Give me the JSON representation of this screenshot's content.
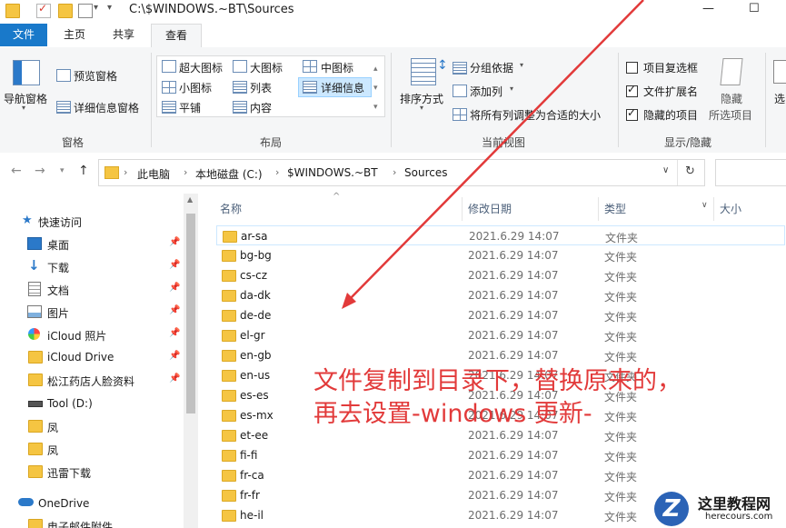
{
  "window": {
    "title": "C:\\$WINDOWS.~BT\\Sources",
    "minimize_glyph": "—",
    "maximize_glyph": "☐"
  },
  "tabs": [
    {
      "label": "文件"
    },
    {
      "label": "主页"
    },
    {
      "label": "共享"
    },
    {
      "label": "查看"
    }
  ],
  "ribbon": {
    "panes": {
      "nav_pane": "导航窗格",
      "preview_pane": "预览窗格",
      "details_pane": "详细信息窗格",
      "group_label": "窗格"
    },
    "layout": {
      "items": [
        "超大图标",
        "大图标",
        "中图标",
        "小图标",
        "列表",
        "详细信息",
        "平铺",
        "内容"
      ],
      "group_label": "布局"
    },
    "current_view": {
      "sort": "排序方式",
      "group_by": "分组依据",
      "add_column": "添加列",
      "fit_columns": "将所有列调整为合适的大小",
      "group_label": "当前视图"
    },
    "show_hide": {
      "item_checkbox": "项目复选框",
      "file_ext": "文件扩展名",
      "hidden_items": "隐藏的项目",
      "hide": "隐藏",
      "selected_items": "所选项目",
      "group_label": "显示/隐藏"
    },
    "options_partial": "选"
  },
  "address": {
    "crumbs": [
      "此电脑",
      "本地磁盘 (C:)",
      "$WINDOWS.~BT",
      "Sources"
    ]
  },
  "nav": {
    "quick_access": "快速访问",
    "items": [
      {
        "label": "桌面"
      },
      {
        "label": "下载"
      },
      {
        "label": "文档"
      },
      {
        "label": "图片"
      },
      {
        "label": "iCloud 照片"
      },
      {
        "label": "iCloud Drive"
      },
      {
        "label": "松江药店人脸资料"
      },
      {
        "label": "Tool (D:)"
      },
      {
        "label": "凤"
      },
      {
        "label": "凤"
      },
      {
        "label": "迅雷下载"
      }
    ],
    "onedrive": "OneDrive",
    "onedrive_child": "电子邮件附件"
  },
  "columns": {
    "name": "名称",
    "date": "修改日期",
    "type": "类型",
    "size": "大小"
  },
  "files": [
    {
      "name": "ar-sa",
      "date": "2021.6.29 14:07",
      "type": "文件夹"
    },
    {
      "name": "bg-bg",
      "date": "2021.6.29 14:07",
      "type": "文件夹"
    },
    {
      "name": "cs-cz",
      "date": "2021.6.29 14:07",
      "type": "文件夹"
    },
    {
      "name": "da-dk",
      "date": "2021.6.29 14:07",
      "type": "文件夹"
    },
    {
      "name": "de-de",
      "date": "2021.6.29 14:07",
      "type": "文件夹"
    },
    {
      "name": "el-gr",
      "date": "2021.6.29 14:07",
      "type": "文件夹"
    },
    {
      "name": "en-gb",
      "date": "2021.6.29 14:07",
      "type": "文件夹"
    },
    {
      "name": "en-us",
      "date": "2021.6.29 14:07",
      "type": "文件夹"
    },
    {
      "name": "es-es",
      "date": "2021.6.29 14:07",
      "type": "文件夹"
    },
    {
      "name": "es-mx",
      "date": "2021.6.29 14:07",
      "type": "文件夹"
    },
    {
      "name": "et-ee",
      "date": "2021.6.29 14:07",
      "type": "文件夹"
    },
    {
      "name": "fi-fi",
      "date": "2021.6.29 14:07",
      "type": "文件夹"
    },
    {
      "name": "fr-ca",
      "date": "2021.6.29 14:07",
      "type": "文件夹"
    },
    {
      "name": "fr-fr",
      "date": "2021.6.29 14:07",
      "type": "文件夹"
    },
    {
      "name": "he-il",
      "date": "2021.6.29 14:07",
      "type": "文件夹"
    }
  ],
  "annotation": {
    "line1": "文件复制到目录下，替换原来的，",
    "line2": "再去设置-windows 更新-"
  },
  "watermark": {
    "logo_letter": "Z",
    "name": "这里教程网",
    "url": "herecours.com"
  },
  "colors": {
    "accent": "#1979ca",
    "annotation": "#e23a3a",
    "folder": "#f5c542"
  }
}
